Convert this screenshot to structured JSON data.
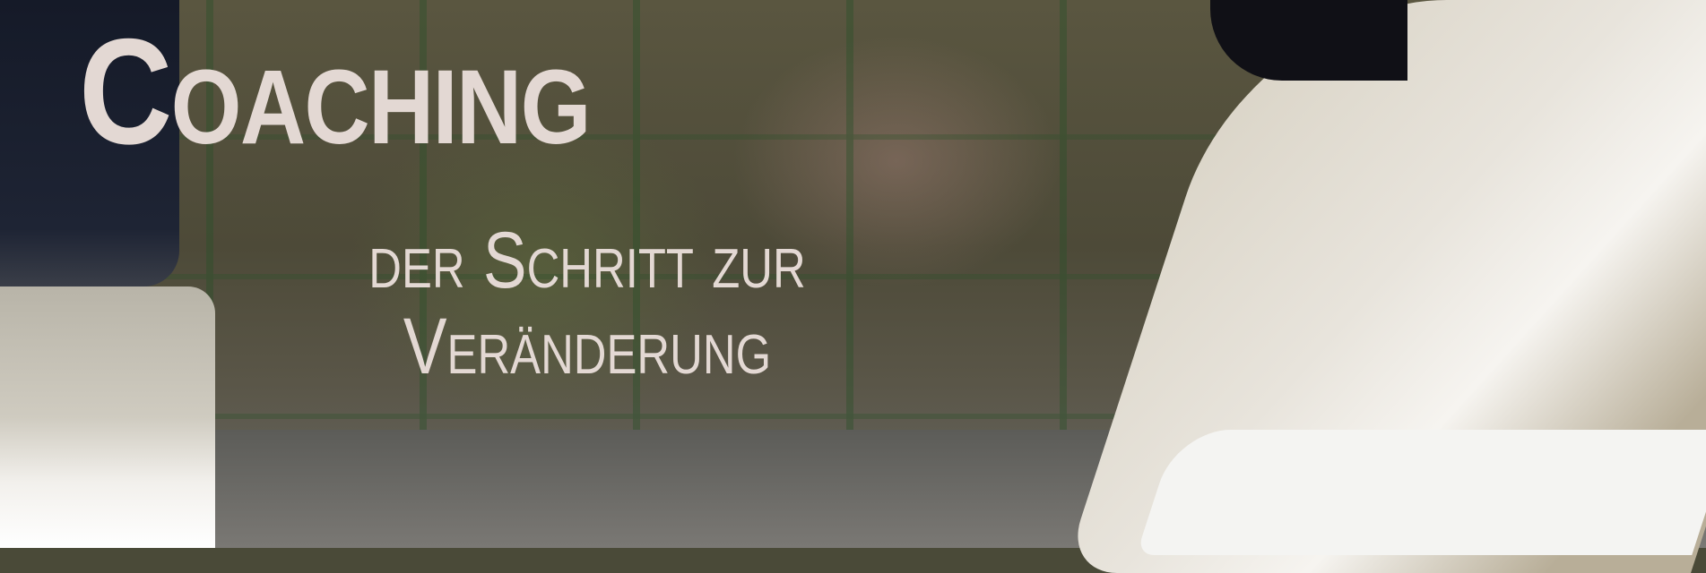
{
  "banner": {
    "title": "Coaching",
    "subtitle_line1": "der Schritt zur",
    "subtitle_line2": "Veränderung",
    "text_color": "#e3d8d3"
  }
}
